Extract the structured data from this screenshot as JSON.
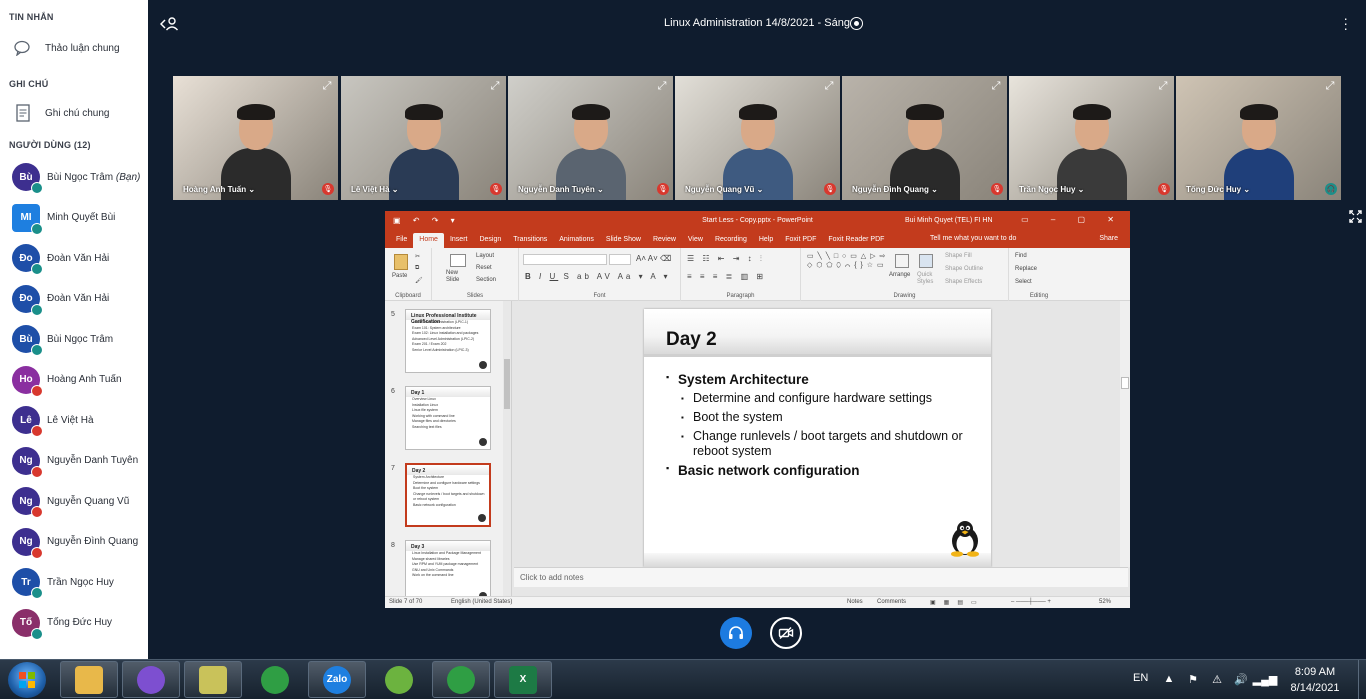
{
  "sidebar": {
    "messages_header": "TIN NHẮN",
    "group_chat_label": "Thảo luận chung",
    "notes_header": "GHI CHÚ",
    "shared_notes_label": "Ghi chú chung",
    "users_header": "NGƯỜI DÙNG (12)",
    "users": [
      {
        "initials": "Bù",
        "name": "Bùi Ngọc Trâm",
        "suffix": "(Bạn)",
        "color": "#3d2f8f",
        "status": "teal"
      },
      {
        "initials": "MI",
        "name": "Minh Quyết Bùi",
        "suffix": "",
        "color": "#1e7fe0",
        "status": "teal"
      },
      {
        "initials": "Đo",
        "name": "Đoàn Văn Hải",
        "suffix": "",
        "color": "#1e4fa8",
        "status": "teal"
      },
      {
        "initials": "Đo",
        "name": "Đoàn Văn Hải",
        "suffix": "",
        "color": "#1e4fa8",
        "status": "teal"
      },
      {
        "initials": "Bù",
        "name": "Bùi Ngọc Trâm",
        "suffix": "",
        "color": "#1e4fa8",
        "status": "teal"
      },
      {
        "initials": "Ho",
        "name": "Hoàng Anh Tuấn",
        "suffix": "",
        "color": "#8a2fa0",
        "status": "red"
      },
      {
        "initials": "Lê",
        "name": "Lê Việt Hà",
        "suffix": "",
        "color": "#3d2f8f",
        "status": "red"
      },
      {
        "initials": "Ng",
        "name": "Nguyễn Danh Tuyên",
        "suffix": "",
        "color": "#3d2f8f",
        "status": "red"
      },
      {
        "initials": "Ng",
        "name": "Nguyễn Quang Vũ",
        "suffix": "",
        "color": "#3d2f8f",
        "status": "red"
      },
      {
        "initials": "Ng",
        "name": "Nguyễn Đình Quang",
        "suffix": "",
        "color": "#3d2f8f",
        "status": "red"
      },
      {
        "initials": "Tr",
        "name": "Trần Ngọc Huy",
        "suffix": "",
        "color": "#1e4fa8",
        "status": "teal"
      },
      {
        "initials": "Tố",
        "name": "Tống Đức Huy",
        "suffix": "",
        "color": "#8a2f6a",
        "status": "teal"
      }
    ]
  },
  "header": {
    "title": "Linux Administration 14/8/2021 - Sáng"
  },
  "videos": [
    {
      "name": "Hoàng Anh Tuấn",
      "mic": "muted",
      "wall": "#e8e0d6",
      "shirt": "#2b2b2b"
    },
    {
      "name": "Lê Việt Hà",
      "mic": "muted",
      "wall": "#c8c6c0",
      "shirt": "#2a3b55"
    },
    {
      "name": "Nguyễn Danh Tuyên",
      "mic": "muted",
      "wall": "#d0cfca",
      "shirt": "#5a6470"
    },
    {
      "name": "Nguyễn Quang Vũ",
      "mic": "muted",
      "wall": "#e2dfd8",
      "shirt": "#3e5a80"
    },
    {
      "name": "Nguyễn Đình Quang",
      "mic": "muted",
      "wall": "#b9b3aa",
      "shirt": "#2a2a2a"
    },
    {
      "name": "Trần Ngọc Huy",
      "mic": "muted",
      "wall": "#e8e4dc",
      "shirt": "#3a3a3a"
    },
    {
      "name": "Tống Đức Huy",
      "mic": "on",
      "wall": "#cfc4b4",
      "shirt": "#1f3f7a"
    }
  ],
  "powerpoint": {
    "file_name": "Start Less - Copy.pptx - PowerPoint",
    "user": "Bui Minh Quyet (TEL) FI HN",
    "tabs": [
      "File",
      "Home",
      "Insert",
      "Design",
      "Transitions",
      "Animations",
      "Slide Show",
      "Review",
      "View",
      "Recording",
      "Help",
      "Foxit PDF",
      "Foxit Reader PDF"
    ],
    "active_tab": "Home",
    "tell_me": "Tell me what you want to do",
    "share": "Share",
    "ribbon": {
      "paste": "Paste",
      "new_slide": "New Slide",
      "layout": "Layout",
      "reset": "Reset",
      "section": "Section",
      "clipboard": "Clipboard",
      "slides": "Slides",
      "font": "Font",
      "paragraph": "Paragraph",
      "drawing": "Drawing",
      "editing": "Editing",
      "arrange": "Arrange",
      "quick_styles": "Quick Styles",
      "shape_fill": "Shape Fill",
      "shape_outline": "Shape Outline",
      "shape_effects": "Shape Effects",
      "find": "Find",
      "replace": "Replace",
      "select": "Select"
    },
    "thumbnails": [
      {
        "num": "5",
        "title": "Linux Professional Institute Certification",
        "lines": [
          "Junior Level Administration (LPIC-1)",
          "Exam 101: System architecture",
          "Exam 102: Linux installation and packages",
          "Advanced Level Administration (LPIC-2)",
          "Exam 201 / Exam 202",
          "Senior Level Administration (LPIC-3)"
        ]
      },
      {
        "num": "6",
        "title": "Day 1",
        "lines": [
          "Overview Linux",
          "Installation Linux",
          "Linux file system",
          "Working with command line",
          "Manage files and directories",
          "Searching text files"
        ]
      },
      {
        "num": "7",
        "title": "Day 2",
        "lines": [
          "System Architecture",
          "Determine and configure hardware settings",
          "Boot the system",
          "Change runlevels / boot targets and shutdown",
          "or reboot system",
          "Basic network configuration"
        ]
      },
      {
        "num": "8",
        "title": "Day 3",
        "lines": [
          "Linux Installation and Package Management",
          "Manage shared libraries",
          "Use RPM and YUM package management",
          "GNU and Unix Commands",
          "Work on the command line"
        ]
      }
    ],
    "slide": {
      "title": "Day 2",
      "items": [
        {
          "level": 1,
          "text": "System Architecture"
        },
        {
          "level": 2,
          "text": "Determine and configure hardware settings"
        },
        {
          "level": 2,
          "text": "Boot the system"
        },
        {
          "level": 2,
          "text": "Change runlevels / boot targets and shutdown or reboot system"
        },
        {
          "level": 1,
          "text": "Basic network configuration"
        }
      ]
    },
    "notes_placeholder": "Click to add notes",
    "status": {
      "slide_count": "Slide 7 of 70",
      "language": "English (United States)",
      "notes": "Notes",
      "comments": "Comments",
      "zoom": "52%"
    }
  },
  "taskbar": {
    "apps": [
      {
        "icon": "file-explorer-icon",
        "color": "#e8b84a",
        "label": ""
      },
      {
        "icon": "viber-icon",
        "color": "#7d4fd0",
        "label": ""
      },
      {
        "icon": "sticky-notes-icon",
        "color": "#c9c25a",
        "label": ""
      },
      {
        "icon": "chrome-icon",
        "color": "#2f9e44",
        "label": ""
      },
      {
        "icon": "zalo-icon",
        "color": "#1e7fe0",
        "label": "Zalo"
      },
      {
        "icon": "clock-app-icon",
        "color": "#6cb33f",
        "label": ""
      },
      {
        "icon": "chrome-profile-icon",
        "color": "#2f9e44",
        "label": ""
      },
      {
        "icon": "excel-icon",
        "color": "#1d7a45",
        "label": "X"
      }
    ],
    "language": "EN",
    "time": "8:09 AM",
    "date": "8/14/2021"
  }
}
